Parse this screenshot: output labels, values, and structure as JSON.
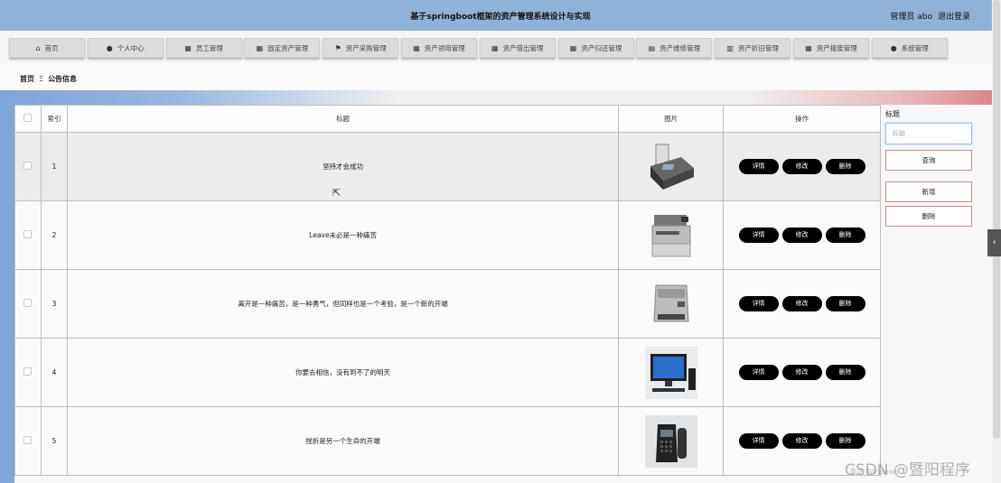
{
  "header": {
    "title": "基于springboot框架的资产管理系统设计与实现",
    "user_label": "管理员 abo",
    "logout_label": "退出登录"
  },
  "nav": [
    {
      "icon": "home-icon",
      "glyph": "⌂",
      "label": "首页"
    },
    {
      "icon": "user-icon",
      "glyph": "●",
      "label": "个人中心"
    },
    {
      "icon": "grid-icon",
      "glyph": "▦",
      "label": "员工管理"
    },
    {
      "icon": "grid-icon",
      "glyph": "▦",
      "label": "固定资产管理"
    },
    {
      "icon": "flag-icon",
      "glyph": "⚑",
      "label": "资产采购管理"
    },
    {
      "icon": "grid-icon",
      "glyph": "▦",
      "label": "资产领用管理"
    },
    {
      "icon": "grid-icon",
      "glyph": "▦",
      "label": "资产借出管理"
    },
    {
      "icon": "grid-icon",
      "glyph": "▦",
      "label": "资产归还管理"
    },
    {
      "icon": "doc-icon",
      "glyph": "▤",
      "label": "资产维修管理"
    },
    {
      "icon": "bar-chart-icon",
      "glyph": "▥",
      "label": "资产折旧管理"
    },
    {
      "icon": "grid-icon",
      "glyph": "▦",
      "label": "资产报废管理"
    },
    {
      "icon": "user-icon",
      "glyph": "●",
      "label": "系统管理"
    }
  ],
  "breadcrumb": {
    "home": "首页",
    "separator": "Ξ",
    "current": "公告信息"
  },
  "table": {
    "columns": {
      "index": "索引",
      "title": "标题",
      "image": "图片",
      "ops": "操作"
    },
    "rows": [
      {
        "index": "1",
        "title": "坚持才会成功",
        "image": "fax"
      },
      {
        "index": "2",
        "title": "Leave未必是一种痛苦",
        "image": "copier"
      },
      {
        "index": "3",
        "title": "离开是一种痛苦，是一种勇气，但同样也是一个考验，是一个新的开端",
        "image": "printer"
      },
      {
        "index": "4",
        "title": "你要去相信，没有到不了的明天",
        "image": "pc"
      },
      {
        "index": "5",
        "title": "挫折是另一个生命的开端",
        "image": "phone"
      }
    ],
    "ops": {
      "detail": "详情",
      "edit": "修改",
      "delete": "删除"
    }
  },
  "side": {
    "title_label": "标题",
    "title_placeholder": "标题",
    "query": "查询",
    "add": "新增",
    "delete": "删除"
  },
  "watermark": "CSDN @暨阳程序",
  "windows_hint": "激活 Windows"
}
